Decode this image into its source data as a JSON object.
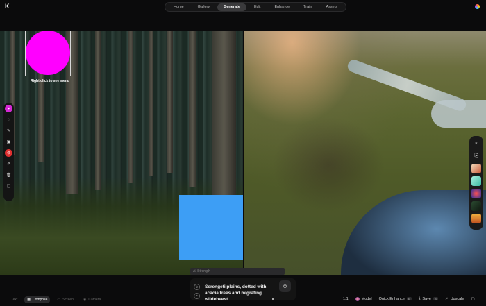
{
  "app": {
    "logo_glyph": "K"
  },
  "nav": {
    "items": [
      "Home",
      "Gallery",
      "Generate",
      "Edit",
      "Enhance",
      "Train",
      "Assets"
    ],
    "active": "Generate"
  },
  "canvas": {
    "context_hint": "Right click to see menu",
    "shapes": {
      "circle_color": "#ff00ff",
      "square_color": "#3d9ef5"
    }
  },
  "left_toolbar": {
    "tools": [
      "pointer-icon",
      "lasso-icon",
      "brush-icon",
      "image-icon",
      "eraser-icon",
      "pen-icon",
      "trash-icon",
      "layers-icon"
    ]
  },
  "right_rail": {
    "buttons": [
      "search-icon",
      "copy-icon"
    ]
  },
  "strength": {
    "label": "AI Strength",
    "value": 0
  },
  "prompt": {
    "text": "Serengeti plains, dotted with acacia trees and migrating wildebeest."
  },
  "bottom_modes": [
    {
      "icon": "text-icon",
      "label": "Text"
    },
    {
      "icon": "compose-icon",
      "label": "Compose"
    },
    {
      "icon": "screen-icon",
      "label": "Screen"
    },
    {
      "icon": "camera-icon",
      "label": "Camera"
    }
  ],
  "actions": {
    "ratio_label": "1:1",
    "model_label": "Model",
    "quick_enhance_label": "Quick Enhance",
    "quick_enhance_kbd": "E",
    "save_label": "Save",
    "save_kbd": "S",
    "upscale_label": "Upscale"
  }
}
